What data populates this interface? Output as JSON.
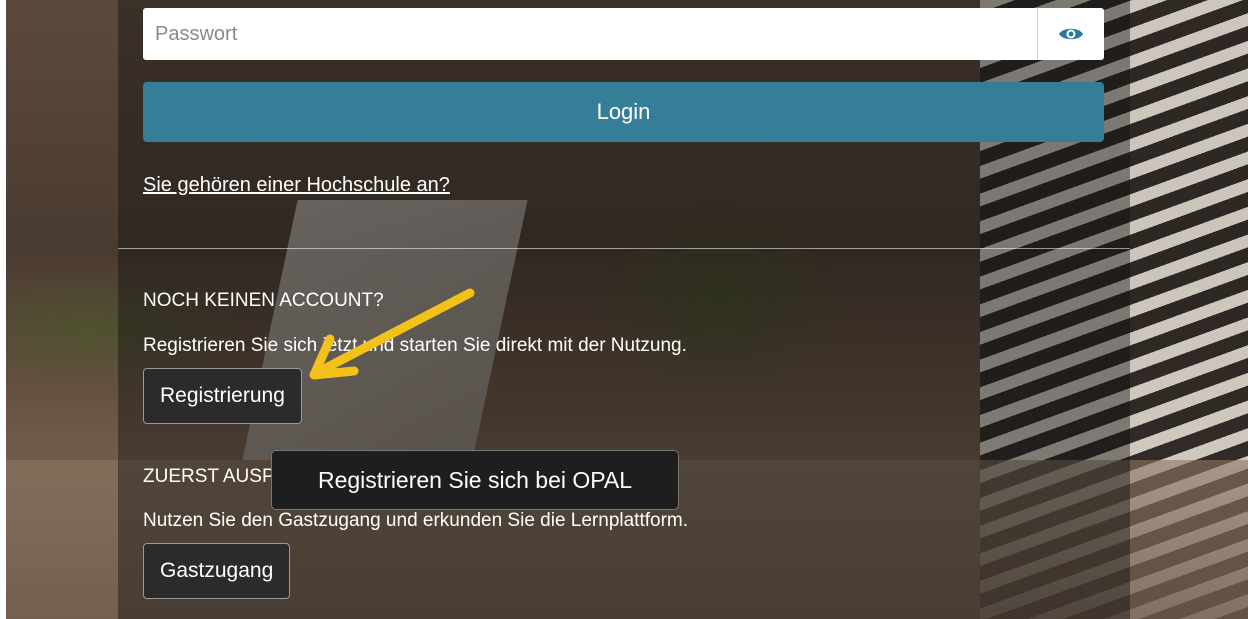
{
  "login": {
    "password_placeholder": "Passwort",
    "eye_icon": "eye-icon",
    "login_label": "Login",
    "hochschule_link": "Sie gehören einer Hochschule an?"
  },
  "register": {
    "heading": "NOCH KEINEN ACCOUNT?",
    "description": "Registrieren Sie sich jetzt und starten Sie direkt mit der Nutzung.",
    "button_label": "Registrierung"
  },
  "guest": {
    "heading": "ZUERST AUSPROBIEREN?",
    "description": "Nutzen Sie den Gastzugang und erkunden Sie die Lernplattform.",
    "button_label": "Gastzugang"
  },
  "tooltip": {
    "text": "Registrieren Sie sich bei OPAL"
  },
  "colors": {
    "accent": "#357e97",
    "eye_icon": "#2a7a9a",
    "annotation_arrow": "#f2c21b"
  }
}
